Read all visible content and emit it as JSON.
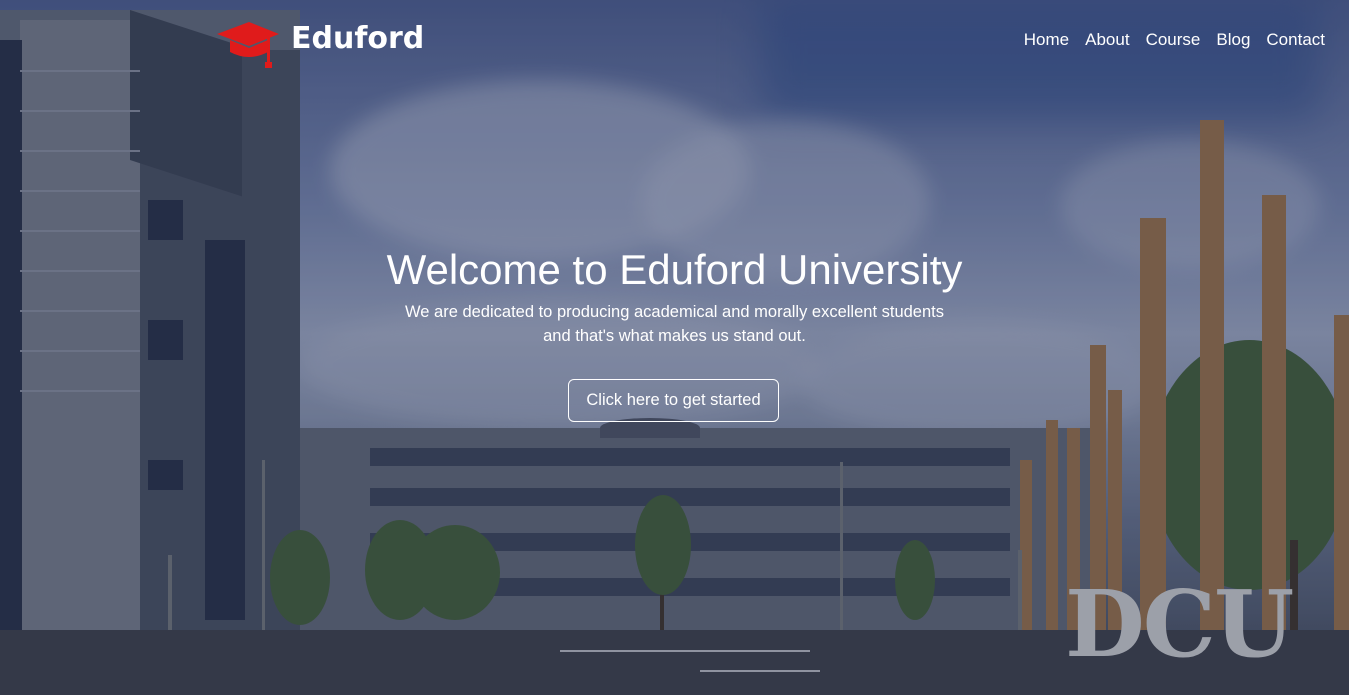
{
  "brand": {
    "name": "Eduford",
    "logo_icon": "graduation-cap-icon",
    "logo_color": "#e01b1b"
  },
  "nav": {
    "items": [
      {
        "label": "Home"
      },
      {
        "label": "About"
      },
      {
        "label": "Course"
      },
      {
        "label": "Blog"
      },
      {
        "label": "Contact"
      }
    ]
  },
  "hero": {
    "title": "Welcome to Eduford University",
    "subtitle_line1": "We are dedicated to producing academical and morally excellent students",
    "subtitle_line2": "and that's what makes us stand out.",
    "cta_label": "Click here to get started",
    "background_sign": "DCU"
  }
}
